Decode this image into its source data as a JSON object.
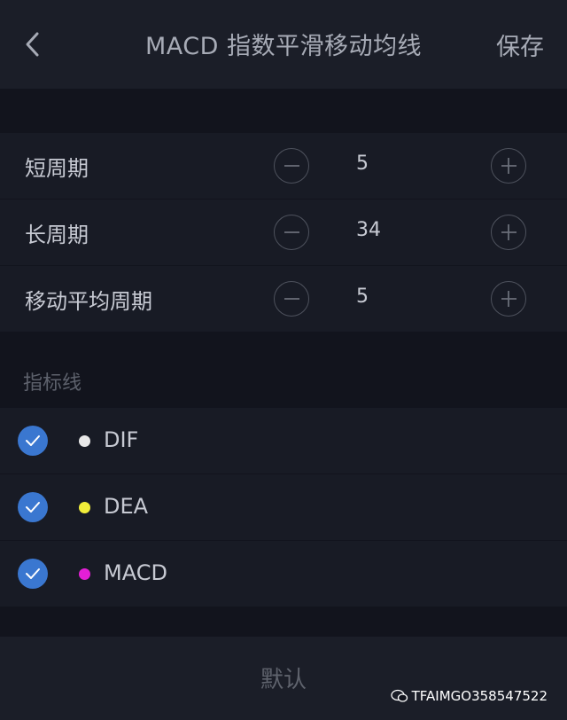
{
  "header": {
    "title": "MACD 指数平滑移动均线",
    "save_label": "保存"
  },
  "params": [
    {
      "label": "短周期",
      "value": "5"
    },
    {
      "label": "长周期",
      "value": "34"
    },
    {
      "label": "移动平均周期",
      "value": "5"
    }
  ],
  "lines_section": {
    "title": "指标线",
    "items": [
      {
        "label": "DIF",
        "color": "#e8e8e8",
        "checked": true
      },
      {
        "label": "DEA",
        "color": "#f2ee3a",
        "checked": true
      },
      {
        "label": "MACD",
        "color": "#e41fd6",
        "checked": true
      }
    ]
  },
  "footer": {
    "default_label": "默认"
  },
  "watermark": {
    "text": "TFAIMGO358547522"
  },
  "icons": [
    "back-chevron-icon",
    "minus-icon",
    "plus-icon",
    "checkmark-icon",
    "wechat-icon"
  ]
}
